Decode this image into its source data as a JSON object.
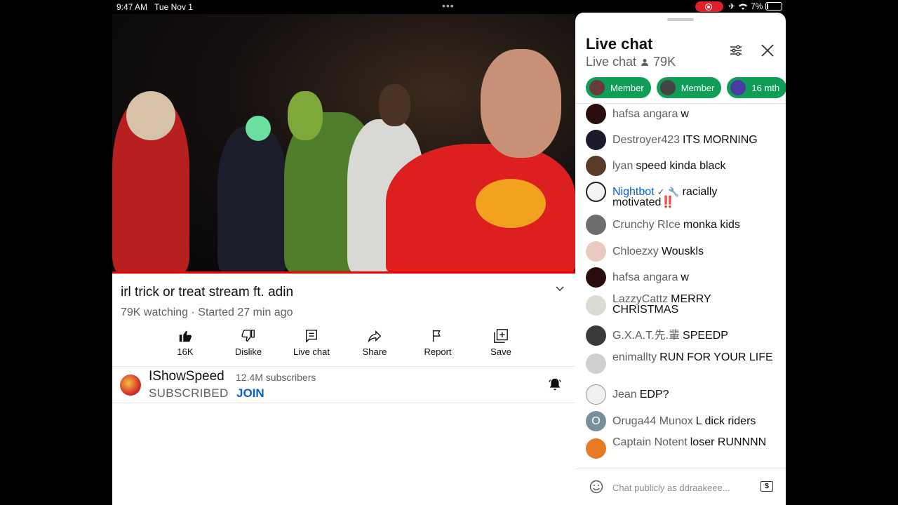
{
  "status_bar": {
    "time": "9:47 AM",
    "date": "Tue Nov 1",
    "battery": "7%"
  },
  "video": {
    "title": "irl trick or treat stream ft. adin",
    "meta": "79K watching · Started 27 min ago"
  },
  "actions": [
    {
      "label": "16K",
      "icon": "thumbs-up-icon"
    },
    {
      "label": "Dislike",
      "icon": "thumbs-down-icon"
    },
    {
      "label": "Live chat",
      "icon": "chat-icon"
    },
    {
      "label": "Share",
      "icon": "share-icon"
    },
    {
      "label": "Report",
      "icon": "flag-icon"
    },
    {
      "label": "Save",
      "icon": "save-icon"
    }
  ],
  "channel": {
    "name": "IShowSpeed",
    "subscribers": "12.4M subscribers",
    "subscribed_label": "SUBSCRIBED",
    "join_label": "JOIN"
  },
  "chat": {
    "title": "Live chat",
    "subtitle": "Live chat",
    "viewer_count": "79K",
    "chips": [
      {
        "label": "Member"
      },
      {
        "label": "Member"
      },
      {
        "label": "16 mth"
      }
    ],
    "messages": [
      {
        "author": "hafsa angara",
        "text": "w"
      },
      {
        "author": "Destroyer423",
        "text": "ITS MORNING"
      },
      {
        "author": "lyan",
        "text": "speed kinda black"
      },
      {
        "author": "Nightbot",
        "text": "racially motivated‼️",
        "moderator": true
      },
      {
        "author": "Crunchy RIce",
        "text": "monka kids"
      },
      {
        "author": "Chloezxy",
        "text": "Wouskls"
      },
      {
        "author": "hafsa angara",
        "text": "w"
      },
      {
        "author": "LazzyCattz",
        "text": "MERRY CHRISTMAS"
      },
      {
        "author": "G.X.A.T.先.輩",
        "text": "SPEEDP"
      },
      {
        "author": "enimallty",
        "text": "RUN FOR YOUR LIFE"
      },
      {
        "author": "Jean",
        "text": "EDP?"
      },
      {
        "author": "Oruga44 Munox",
        "text": "L dick riders",
        "avatar_letter": "O"
      },
      {
        "author": "Captain Notent",
        "text": "loser RUNNNN"
      }
    ],
    "input_placeholder": "Chat publicly as ddraakeee...",
    "superchat_symbol": "$"
  }
}
